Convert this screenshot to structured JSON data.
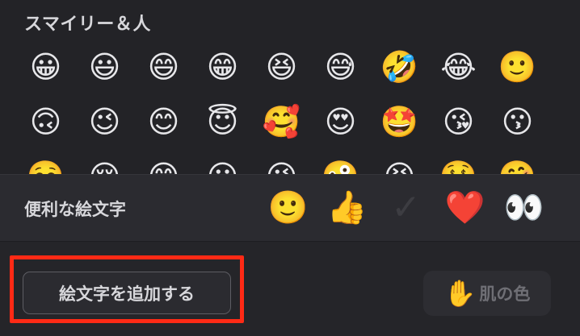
{
  "picker": {
    "category_title": "スマイリー＆人",
    "emoji_rows": [
      [
        "😀",
        "😃",
        "😄",
        "😁",
        "😆",
        "😅",
        "🤣",
        "😂",
        "🙂"
      ],
      [
        "🙃",
        "😉",
        "😊",
        "😇",
        "🥰",
        "😍",
        "🤩",
        "😘",
        "😗"
      ],
      [
        "☺️",
        "😚",
        "😋",
        "😛",
        "😜",
        "🤪",
        "😝",
        "🤑",
        "🤗"
      ]
    ]
  },
  "frequent": {
    "label": "便利な絵文字",
    "emojis": [
      {
        "glyph": "🙂",
        "name": "slightly-smiling-face"
      },
      {
        "glyph": "👍",
        "name": "thumbs-up"
      },
      {
        "glyph": "✓",
        "name": "check-mark"
      },
      {
        "glyph": "❤️",
        "name": "red-heart"
      },
      {
        "glyph": "👀",
        "name": "eyes"
      }
    ]
  },
  "footer": {
    "add_emoji_label": "絵文字を追加する",
    "skin_tone_icon": "✋",
    "skin_tone_label": "肌の色"
  },
  "colors": {
    "highlight": "#ff2a15",
    "background": "#252529"
  }
}
